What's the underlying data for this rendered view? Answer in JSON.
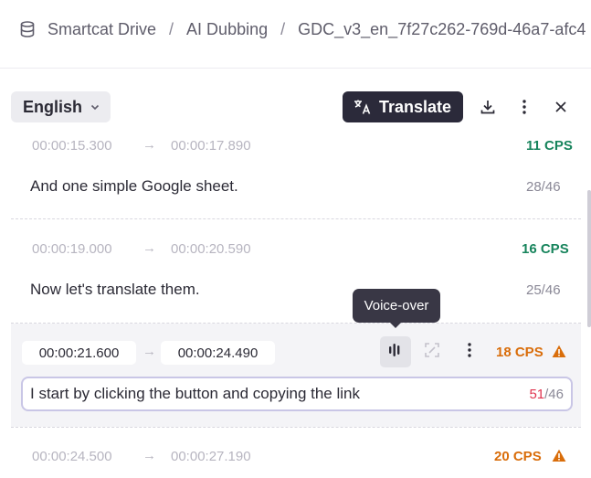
{
  "breadcrumb": {
    "items": [
      "Smartcat Drive",
      "AI Dubbing",
      "GDC_v3_en_7f27c262-769d-46a7-afc4"
    ],
    "separator": "/"
  },
  "toolbar": {
    "language": "English",
    "translate_label": "Translate"
  },
  "tooltip": "Voice-over",
  "segments": [
    {
      "start": "00:00:15.300",
      "end": "00:00:17.890",
      "cps": "11 CPS",
      "cps_status": "ok",
      "text": "And one simple Google sheet.",
      "count": "28/46"
    },
    {
      "start": "00:00:19.000",
      "end": "00:00:20.590",
      "cps": "16 CPS",
      "cps_status": "ok",
      "text": "Now let's translate them.",
      "count": "25/46"
    },
    {
      "start": "00:00:21.600",
      "end": "00:00:24.490",
      "cps": "18 CPS",
      "cps_status": "warning",
      "text": "I start by clicking the button and copying the link",
      "count_used": "51",
      "count_max": "/46"
    },
    {
      "start": "00:00:24.500",
      "end": "00:00:27.190",
      "cps": "20 CPS",
      "cps_status": "warning"
    }
  ],
  "colors": {
    "cps_ok": "#17845c",
    "cps_warning": "#d96d0a",
    "over_limit": "#e0344f",
    "primary_button": "#2b2a3a"
  },
  "icons": [
    "database-icon",
    "chevron-down-icon",
    "translate-icon",
    "download-icon",
    "more-vertical-icon",
    "close-icon",
    "arrow-right-icon",
    "voice-over-icon",
    "expand-icon",
    "warning-icon"
  ]
}
